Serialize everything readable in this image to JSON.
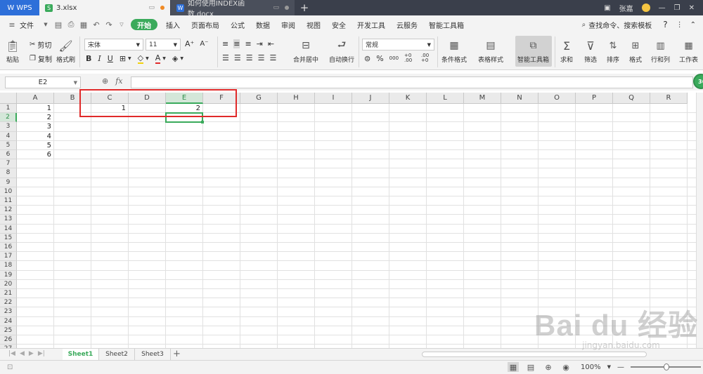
{
  "titlebar": {
    "app_name": "WPS",
    "tabs": [
      {
        "label": "3.xlsx",
        "active": true,
        "icon": "spreadsheet-icon",
        "icon_color": "#3aaa5b"
      },
      {
        "label": "如何使用INDEX函数.docx",
        "active": false,
        "icon": "document-icon",
        "icon_color": "#2d6fd9"
      }
    ],
    "new_tab_label": "+",
    "user_name": "张嘉",
    "window_controls": [
      "min-icon",
      "restore-icon",
      "close-icon"
    ]
  },
  "menubar": {
    "file_label": "文件",
    "items": [
      "开始",
      "插入",
      "页面布局",
      "公式",
      "数据",
      "审阅",
      "视图",
      "安全",
      "开发工具",
      "云服务",
      "智能工具箱"
    ],
    "active_item": "开始",
    "search_label": "查找命令、搜索模板",
    "help_label": "?"
  },
  "ribbon": {
    "paste_label": "粘贴",
    "cut_label": "剪切",
    "copy_label": "复制",
    "format_painter_label": "格式刷",
    "font_name": "宋体",
    "font_size": "11",
    "bold_label": "B",
    "italic_label": "I",
    "underline_label": "U",
    "merge_label": "合并居中",
    "wrap_label": "自动换行",
    "number_format": "常规",
    "percent_label": "%",
    "thousands_label": "000",
    "inc_decimal_label": "+0 .00",
    "dec_decimal_label": ".00 +0",
    "cond_format_label": "条件格式",
    "table_style_label": "表格样式",
    "smart_toolbox_label": "智能工具箱",
    "sum_label": "求和",
    "filter_label": "筛选",
    "sort_label": "排序",
    "format_label": "格式",
    "rowcol_label": "行和列",
    "worksheet_label": "工作表"
  },
  "formula_bar": {
    "name_box": "E2",
    "fx_label": "fx",
    "formula": "",
    "badge_label": "36"
  },
  "sheet": {
    "columns": [
      "A",
      "B",
      "C",
      "D",
      "E",
      "F",
      "G",
      "H",
      "I",
      "J",
      "K",
      "L",
      "M",
      "N",
      "O",
      "P",
      "Q",
      "R"
    ],
    "rows": [
      "1",
      "2",
      "3",
      "4",
      "5",
      "6",
      "7",
      "8",
      "9",
      "10",
      "11",
      "12",
      "13",
      "14",
      "15",
      "16",
      "17",
      "18",
      "19",
      "20",
      "21",
      "22",
      "23",
      "24",
      "25",
      "26",
      "27"
    ],
    "selected_column": "E",
    "selected_row": "2",
    "cells": [
      {
        "ref": "A1",
        "value": "1"
      },
      {
        "ref": "A2",
        "value": "2"
      },
      {
        "ref": "A3",
        "value": "3"
      },
      {
        "ref": "A4",
        "value": "4"
      },
      {
        "ref": "A5",
        "value": "5"
      },
      {
        "ref": "A6",
        "value": "6"
      },
      {
        "ref": "C1",
        "value": "1"
      },
      {
        "ref": "E1",
        "value": "2"
      }
    ]
  },
  "sheet_tabs": {
    "tabs": [
      "Sheet1",
      "Sheet2",
      "Sheet3"
    ],
    "active": "Sheet1",
    "add_label": "+"
  },
  "statusbar": {
    "zoom": "100%",
    "zoom_out_label": "—",
    "zoom_in_label": "+"
  },
  "watermark": {
    "brand": "Bai du 经验",
    "url": "jingyan.baidu.com"
  }
}
